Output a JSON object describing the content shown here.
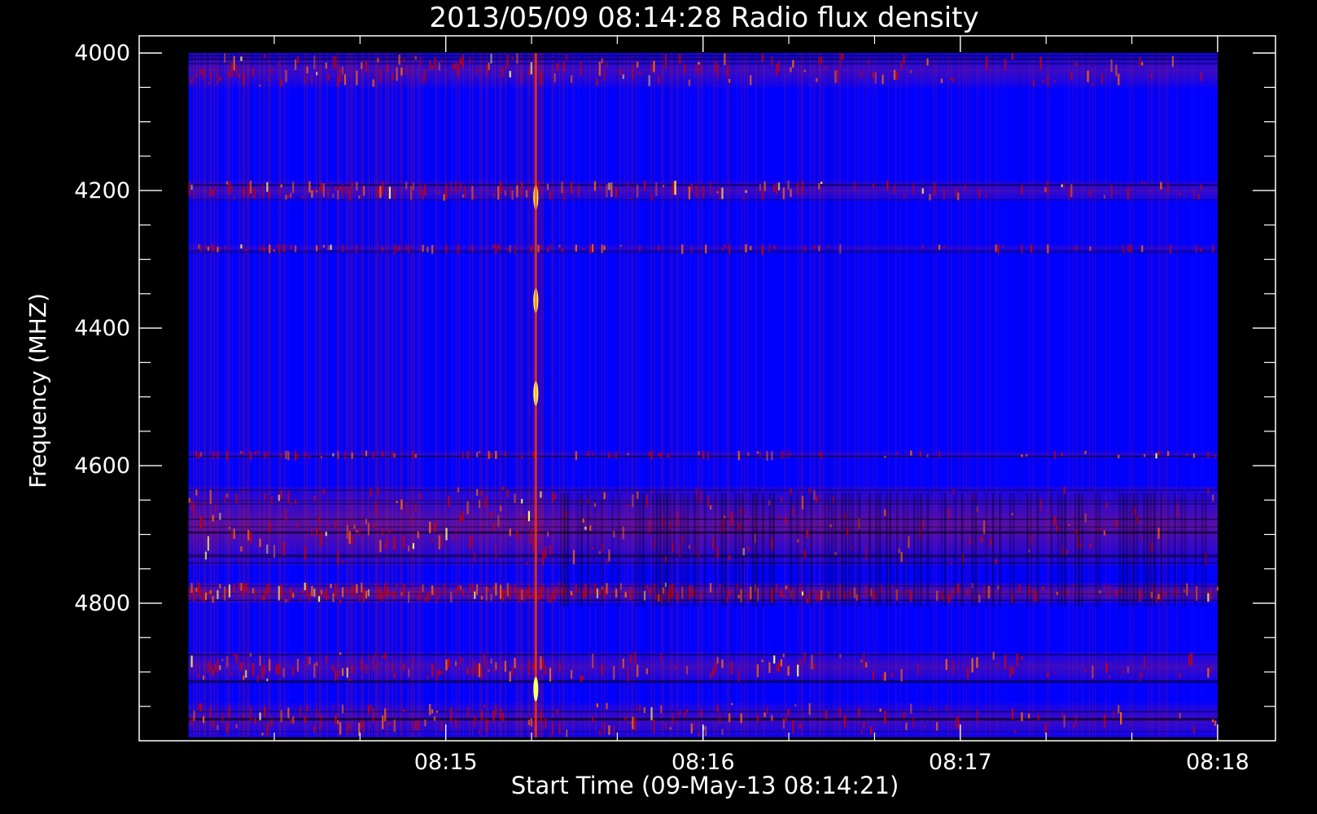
{
  "chart_data": {
    "type": "heatmap",
    "title": "2013/05/09 08:14:28 Radio flux density",
    "xlabel": "Start Time (09-May-13 08:14:21)",
    "ylabel": "Frequency (MHZ)",
    "x_ticks": [
      "08:15",
      "08:16",
      "08:17",
      "08:18"
    ],
    "y_ticks": [
      "4000",
      "4200",
      "4400",
      "4600",
      "4800"
    ],
    "x_tick_values_sec": [
      60,
      120,
      180,
      240
    ],
    "y_tick_values_mhz": [
      4000,
      4200,
      4400,
      4600,
      4800
    ],
    "xlim_sec": [
      -11.5,
      253.5
    ],
    "ylim_mhz": [
      3975,
      5000
    ],
    "data_extent": {
      "x_start_sec": 0,
      "x_end_sec": 240,
      "y_start_mhz": 4000,
      "y_end_mhz": 4995
    },
    "colormap": [
      "#000000",
      "#0000ff",
      "#cc0000",
      "#ff6600",
      "#ffff66"
    ],
    "background_value": "blue",
    "bright_frequency_bands_mhz": [
      {
        "from": 4000,
        "to": 4050,
        "level": "medium"
      },
      {
        "from": 4185,
        "to": 4215,
        "level": "medium"
      },
      {
        "from": 4278,
        "to": 4290,
        "level": "weak"
      },
      {
        "from": 4578,
        "to": 4590,
        "level": "weak"
      },
      {
        "from": 4630,
        "to": 4745,
        "level": "strong"
      },
      {
        "from": 4770,
        "to": 4800,
        "level": "strong"
      },
      {
        "from": 4870,
        "to": 4915,
        "level": "medium"
      },
      {
        "from": 4945,
        "to": 4995,
        "level": "medium"
      }
    ],
    "active_time_intervals_sec": [
      {
        "from": 0,
        "to": 60,
        "level": "strong"
      },
      {
        "from": 60,
        "to": 85,
        "level": "strong"
      },
      {
        "from": 85,
        "to": 150,
        "level": "medium"
      },
      {
        "from": 150,
        "to": 240,
        "level": "weak"
      }
    ],
    "spike_events": [
      {
        "time_sec": 81,
        "freq_mhz": 4210
      },
      {
        "time_sec": 81,
        "freq_mhz": 4360
      },
      {
        "time_sec": 81,
        "freq_mhz": 4495
      },
      {
        "time_sec": 81,
        "freq_mhz": 4925
      }
    ],
    "grid": false,
    "legend": "none"
  }
}
